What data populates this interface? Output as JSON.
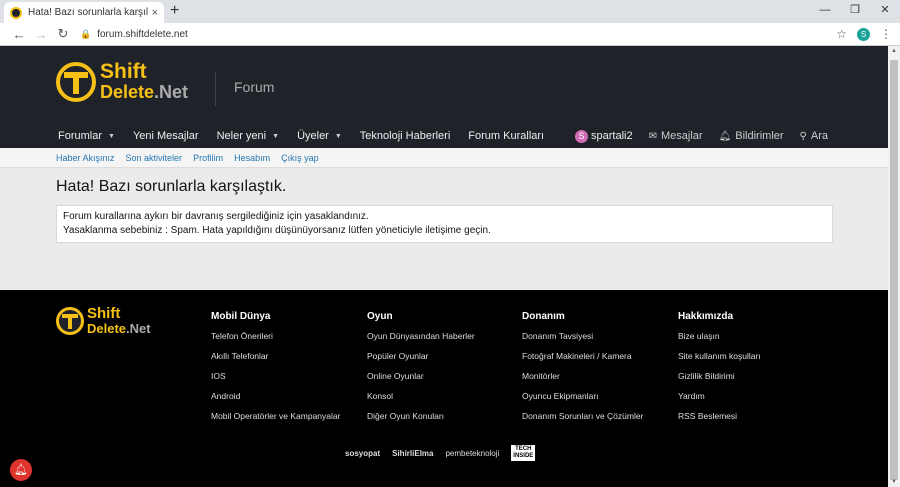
{
  "browser": {
    "tab_title": "Hata! Bazı sorunlarla karşılaştık. |",
    "tab_close": "×",
    "new_tab": "+",
    "url": "forum.shiftdelete.net",
    "profile_initial": "S",
    "window_controls": [
      "—",
      "❐",
      "✕"
    ]
  },
  "header": {
    "logo_shift": "Shift",
    "logo_delete": "Delete",
    "logo_net": ".Net",
    "section_label": "Forum"
  },
  "nav": {
    "items": [
      {
        "label": "Forumlar",
        "has_caret": true
      },
      {
        "label": "Yeni Mesajlar",
        "has_caret": false
      },
      {
        "label": "Neler yeni",
        "has_caret": true
      },
      {
        "label": "Üyeler",
        "has_caret": true
      },
      {
        "label": "Teknoloji Haberleri",
        "has_caret": false
      },
      {
        "label": "Forum Kuralları",
        "has_caret": false
      }
    ],
    "user": {
      "avatar_letter": "S",
      "name": "spartali2"
    },
    "messages": "Mesajlar",
    "alerts": "Bildirimler",
    "search": "Ara"
  },
  "subnav": [
    "Haber Akışınız",
    "Son aktiviteler",
    "Profilim",
    "Hesabım",
    "Çıkış yap"
  ],
  "content": {
    "title": "Hata! Bazı sorunlarla karşılaştık.",
    "error_line1": "Forum kurallarına aykırı bir davranış sergilediğiniz için yasaklandınız.",
    "error_line2": "Yasaklanma sebebiniz : Spam. Hata yapıldığını düşünüyorsanız lütfen yöneticiyle iletişime geçin."
  },
  "footer": {
    "columns": [
      {
        "heading": "Mobil Dünya",
        "links": [
          "Telefon Önerileri",
          "Akıllı Telefonlar",
          "IOS",
          "Android",
          "Mobil Operatörler ve Kampanyalar"
        ]
      },
      {
        "heading": "Oyun",
        "links": [
          "Oyun Dünyasından Haberler",
          "Popüler Oyunlar",
          "Online Oyunlar",
          "Konsol",
          "Diğer Oyun Konuları"
        ]
      },
      {
        "heading": "Donanım",
        "links": [
          "Donanım Tavsiyesi",
          "Fotoğraf Makineleri / Kamera",
          "Monitörler",
          "Oyuncu Ekipmanları",
          "Donanım Sorunları ve Çözümler"
        ]
      },
      {
        "heading": "Hakkımızda",
        "links": [
          "Bize ulaşın",
          "Site kullanım koşulları",
          "Gizlilik Bildirimi",
          "Yardım",
          "RSS Beslemesi"
        ]
      }
    ],
    "partners": [
      "sosyopat",
      "SihirliElma",
      "pembeteknoloji"
    ],
    "tech_line1": "TECH",
    "tech_line2": "INSIDE"
  },
  "colors": {
    "accent": "#f5c017",
    "header_bg": "#1f2228",
    "link": "#2577b1",
    "notification": "#e0332d"
  }
}
